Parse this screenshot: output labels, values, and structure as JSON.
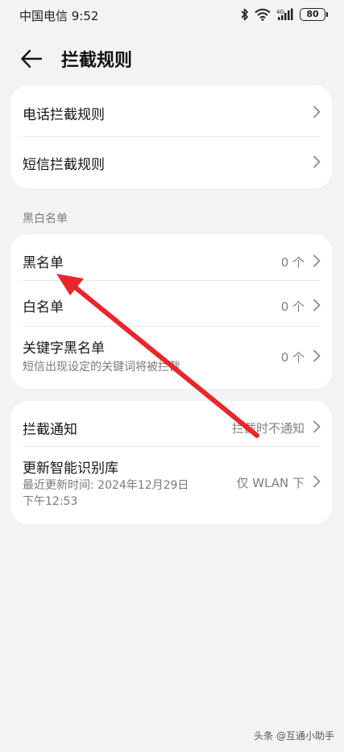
{
  "status_bar": {
    "carrier_time": "中国电信 9:52",
    "battery": "80",
    "icons": [
      "bluetooth-icon",
      "wifi-icon",
      "4g-signal-icon",
      "battery-icon"
    ]
  },
  "header": {
    "back_icon": "arrow-left-icon",
    "title": "拦截规则"
  },
  "rules_card": {
    "items": [
      {
        "title": "电话拦截规则"
      },
      {
        "title": "短信拦截规则"
      }
    ]
  },
  "blackwhite": {
    "section_label": "黑白名单",
    "items": [
      {
        "title": "黑名单",
        "value": "0 个"
      },
      {
        "title": "白名单",
        "value": "0 个"
      },
      {
        "title": "关键字黑名单",
        "subtitle": "短信出现设定的关键词将被拦截",
        "value": "0 个"
      }
    ]
  },
  "notify_card": {
    "items": [
      {
        "title": "拦截通知",
        "value": "拦截时不通知"
      },
      {
        "title": "更新智能识别库",
        "subtitle_line1": "最近更新时间: 2024年12月29日",
        "subtitle_line2": "下午12:53",
        "value": "仅 WLAN 下"
      }
    ]
  },
  "watermark": "头条 @互通小助手",
  "colors": {
    "background": "#f1f3f5",
    "card": "#ffffff",
    "annotation_arrow": "#e8262c"
  }
}
